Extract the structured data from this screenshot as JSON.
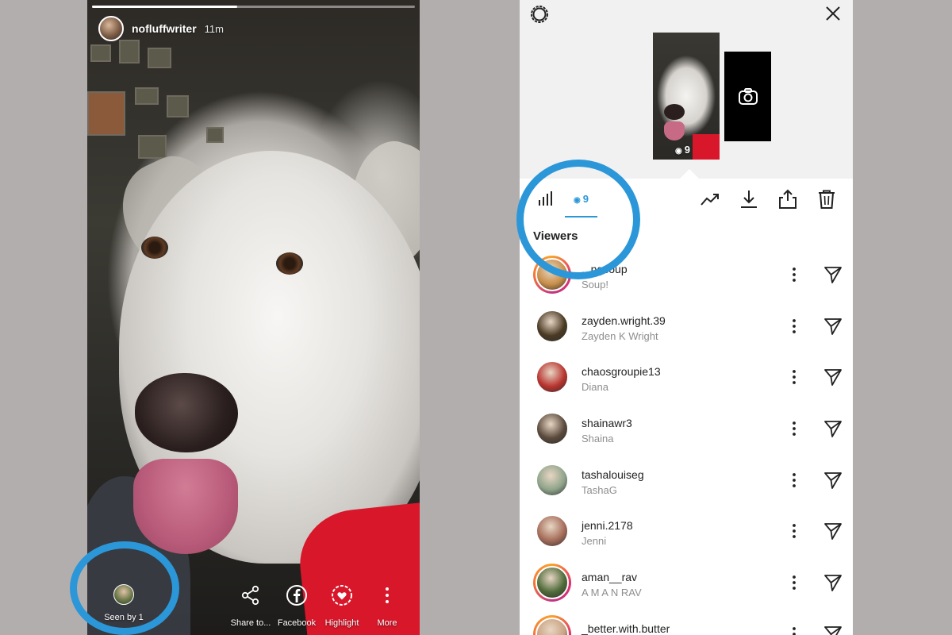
{
  "story": {
    "username": "nofluffwriter",
    "time": "11m",
    "progress": 0.45,
    "seen_by_label": "Seen by 1",
    "actions": [
      {
        "label": "Share to...",
        "icon": "share-icon"
      },
      {
        "label": "Facebook",
        "icon": "facebook-icon"
      },
      {
        "label": "Highlight",
        "icon": "highlight-heart-icon"
      },
      {
        "label": "More",
        "icon": "more-vertical-icon"
      }
    ]
  },
  "panel": {
    "thumb_view_count": "9",
    "viewers_tab_count": "9",
    "viewers_heading": "Viewers",
    "viewers": [
      {
        "username": "...ngsoup",
        "name": "Soup!",
        "story_ring": true,
        "avatar_color": "#c98f4a"
      },
      {
        "username": "zayden.wright.39",
        "name": "Zayden K Wright",
        "story_ring": false,
        "avatar_color": "#4a3a24"
      },
      {
        "username": "chaosgroupie13",
        "name": "Diana",
        "story_ring": false,
        "avatar_color": "#b8342f"
      },
      {
        "username": "shainawr3",
        "name": "Shaina",
        "story_ring": false,
        "avatar_color": "#5a4a3c"
      },
      {
        "username": "tashalouiseg",
        "name": "TashaG",
        "story_ring": false,
        "avatar_color": "#8fa48a"
      },
      {
        "username": "jenni.2178",
        "name": "Jenni",
        "story_ring": false,
        "avatar_color": "#a56d5a"
      },
      {
        "username": "aman__rav",
        "name": "A M A N RAV",
        "story_ring": true,
        "avatar_color": "#4f6b3a"
      },
      {
        "username": "_better.with.butter",
        "name": "",
        "story_ring": true,
        "avatar_color": "#c9a382"
      }
    ]
  },
  "colors": {
    "accent": "#2b97d8",
    "background": "#b3aeae",
    "story_red": "#d8172a"
  }
}
